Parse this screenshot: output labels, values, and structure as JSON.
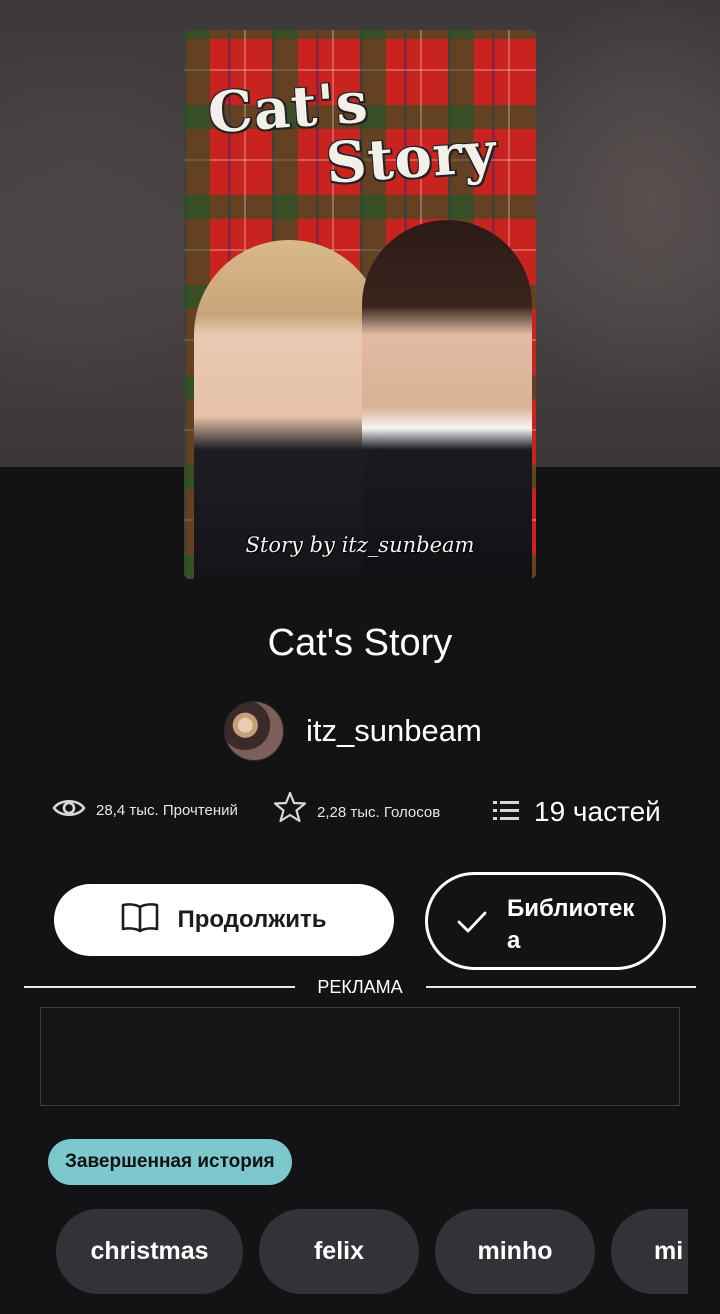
{
  "story": {
    "title": "Cat's Story",
    "cover": {
      "title_line1": "Cat's",
      "title_line2": "Story",
      "credit": "Story by itz_sunbeam"
    },
    "author": "itz_sunbeam",
    "stats": {
      "reads": "28,4 тыс. Прочтений",
      "votes": "2,28 тыс. Голосов",
      "parts": "19 частей"
    },
    "status_badge": "Завершенная история",
    "tags": [
      "christmas",
      "felix",
      "minho",
      "mi"
    ]
  },
  "actions": {
    "continue_label": "Продолжить",
    "library_label": "Библиотека"
  },
  "ad": {
    "label": "РЕКЛАМА"
  },
  "colors": {
    "background": "#131214",
    "badge": "#7cc8cc",
    "tag_bg": "#333236",
    "primary_button": "#ffffff"
  },
  "icons": {
    "reads": "eye-icon",
    "votes": "star-icon",
    "parts": "list-icon",
    "continue": "book-icon",
    "library": "check-icon"
  }
}
